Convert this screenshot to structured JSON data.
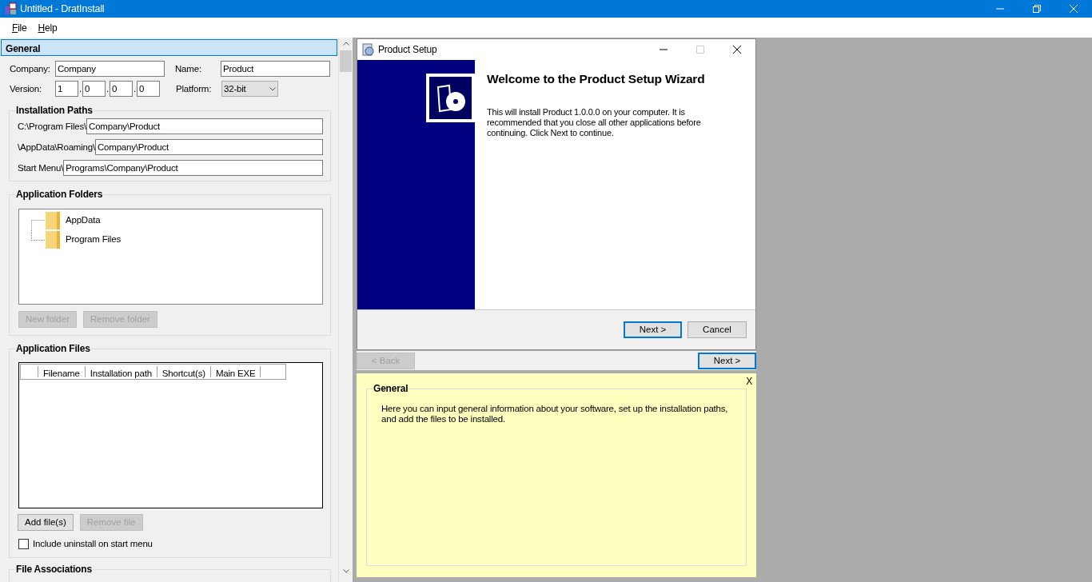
{
  "window": {
    "title": "Untitled - DratInstall"
  },
  "menu": [
    {
      "label": "File"
    },
    {
      "label": "Help"
    }
  ],
  "general": {
    "header": {
      "label": "General",
      "selected": true
    },
    "company": {
      "label": "Company:",
      "value": "Company"
    },
    "name": {
      "label": "Name:",
      "value": "Product"
    },
    "version": {
      "label": "Version:",
      "segments": [
        {
          "kind": "field",
          "value": "1"
        },
        {
          "kind": "dot",
          "text": "."
        },
        {
          "kind": "field",
          "value": "0"
        },
        {
          "kind": "dot",
          "text": "."
        },
        {
          "kind": "field",
          "value": "0"
        },
        {
          "kind": "dot",
          "text": "."
        },
        {
          "kind": "field",
          "value": "0"
        }
      ]
    },
    "platform": {
      "label": "Platform:",
      "value": "32-bit"
    }
  },
  "installation_paths": {
    "title": "Installation Paths",
    "rows": [
      {
        "prefix": "C:\\Program Files\\",
        "value": "Company\\Product"
      },
      {
        "prefix": "\\AppData\\Roaming\\",
        "value": "Company\\Product"
      },
      {
        "prefix": "Start Menu\\",
        "value": "Programs\\Company\\Product"
      }
    ]
  },
  "application_folders": {
    "title": "Application Folders",
    "tree": [
      {
        "label": "AppData"
      },
      {
        "label": "Program Files"
      }
    ],
    "buttons": [
      {
        "label": "New folder",
        "disabled": true
      },
      {
        "label": "Remove folder",
        "disabled": true
      }
    ]
  },
  "application_files": {
    "title": "Application Files",
    "columns": [
      "Filename",
      "Installation path",
      "Shortcut(s)",
      "Main EXE"
    ],
    "buttons": [
      {
        "label": "Add file(s)",
        "disabled": false
      },
      {
        "label": "Remove file",
        "disabled": true
      }
    ],
    "checkbox": {
      "label": "Include uninstall on start menu",
      "checked": false
    }
  },
  "file_associations": {
    "title": "File Associations"
  },
  "preview": {
    "title": "Product Setup",
    "heading": "Welcome to the Product Setup Wizard",
    "body": "This will install Product 1.0.0.0 on your computer. It is recommended that you close all other applications before continuing. Click Next to continue.",
    "buttons": [
      {
        "label": "Next >",
        "focused": true
      },
      {
        "label": "Cancel",
        "focused": false
      }
    ]
  },
  "navigation": [
    {
      "label": "< Back",
      "disabled": true,
      "focused": false
    },
    {
      "label": "Next >",
      "disabled": false,
      "focused": true
    }
  ],
  "help": {
    "title": "General",
    "text": "Here you can input general information about your software, set up the installation paths, and add the files to be installed.",
    "close": "X"
  }
}
